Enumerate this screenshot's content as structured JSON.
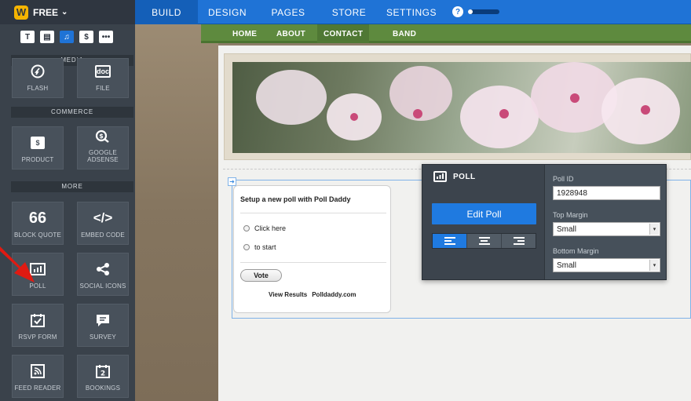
{
  "topbar": {
    "brand": "FREE",
    "nav": [
      {
        "label": "BUILD",
        "active": true
      },
      {
        "label": "DESIGN",
        "active": false
      },
      {
        "label": "PAGES",
        "active": false
      },
      {
        "label": "STORE",
        "active": false
      },
      {
        "label": "SETTINGS",
        "active": false
      }
    ],
    "help_icon": "?",
    "progress": 0.15
  },
  "sidebar": {
    "tools": [
      "T",
      "▤",
      "♫",
      "$",
      "•••"
    ],
    "media_label": "MEDIA",
    "media": [
      {
        "label": "FLASH",
        "icon": "flash-icon"
      },
      {
        "label": "FILE",
        "icon": "file-icon",
        "glyph": "doc"
      }
    ],
    "commerce_label": "COMMERCE",
    "commerce": [
      {
        "label": "PRODUCT",
        "icon": "dollar-icon",
        "glyph": "$"
      },
      {
        "label": "GOOGLE ADSENSE",
        "icon": "adsense-icon"
      }
    ],
    "more_label": "MORE",
    "more": [
      {
        "label": "BLOCK QUOTE",
        "icon": "quote-icon",
        "glyph": "66"
      },
      {
        "label": "EMBED CODE",
        "icon": "code-icon",
        "glyph": "</>"
      },
      {
        "label": "POLL",
        "icon": "poll-icon"
      },
      {
        "label": "SOCIAL ICONS",
        "icon": "share-icon"
      },
      {
        "label": "RSVP FORM",
        "icon": "rsvp-icon"
      },
      {
        "label": "SURVEY",
        "icon": "survey-icon"
      },
      {
        "label": "FEED READER",
        "icon": "rss-icon"
      },
      {
        "label": "BOOKINGS",
        "icon": "calendar-icon",
        "glyph": "2"
      }
    ]
  },
  "site": {
    "nav": [
      "HOME",
      "ABOUT",
      "CONTACT",
      "BAND"
    ],
    "current": "CONTACT"
  },
  "poll_widget": {
    "question": "Setup a new poll with Poll Daddy",
    "options": [
      "Click here",
      "to start"
    ],
    "vote_label": "Vote",
    "results_label": "View Results",
    "brand_label": "Polldaddy.com"
  },
  "settings_panel": {
    "title": "POLL",
    "edit_button": "Edit Poll",
    "alignment": "left",
    "poll_id_label": "Poll ID",
    "poll_id_value": "1928948",
    "top_margin_label": "Top Margin",
    "top_margin_value": "Small",
    "bottom_margin_label": "Bottom Margin",
    "bottom_margin_value": "Small"
  },
  "colors": {
    "accent": "#1f73d6",
    "sidebar": "#3a424b",
    "site_nav": "#5e8a3e",
    "arrow": "#e01a12"
  }
}
